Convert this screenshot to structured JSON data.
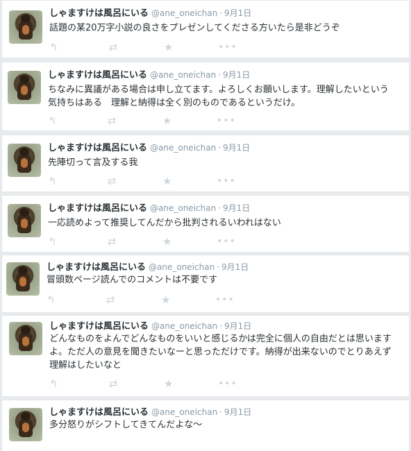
{
  "tweets": [
    {
      "name": "しゃますけは風呂にいる",
      "handle": "@ane_oneichan",
      "dot": "·",
      "date": "9月1日",
      "text": "話題の某20万字小説の良さをプレゼンしてくださる方いたら是非どうぞ"
    },
    {
      "name": "しゃますけは風呂にいる",
      "handle": "@ane_oneichan",
      "dot": "·",
      "date": "9月1日",
      "text": "ちなみに異議がある場合は申し立てます。よろしくお願いします。理解したいという気持ちはある　理解と納得は全く別のものであるというだけ。"
    },
    {
      "name": "しゃますけは風呂にいる",
      "handle": "@ane_oneichan",
      "dot": "·",
      "date": "9月1日",
      "text": "先陣切って言及する我"
    },
    {
      "name": "しゃますけは風呂にいる",
      "handle": "@ane_oneichan",
      "dot": "·",
      "date": "9月1日",
      "text": "一応読めよって推奨してんだから批判されるいわれはない"
    },
    {
      "name": "しゃますけは風呂にいる",
      "handle": "@ane_oneichan",
      "dot": "·",
      "date": "9月1日",
      "text": "冒頭数ページ読んでのコメントは不要です"
    },
    {
      "name": "しゃますけは風呂にいる",
      "handle": "@ane_oneichan",
      "dot": "·",
      "date": "9月1日",
      "text": "どんなものをよんでどんなものをいいと感じるかは完全に個人の自由だとは思いますよ。ただ人の意見を聞きたいなーと思っただけです。納得が出来ないのでとりあえず理解はしたいなと"
    },
    {
      "name": "しゃますけは風呂にいる",
      "handle": "@ane_oneichan",
      "dot": "·",
      "date": "9月1日",
      "text": "多分怒りがシフトしてきてんだよな〜"
    }
  ],
  "icons": {
    "reply": "reply-icon",
    "retweet": "retweet-icon",
    "favorite": "star-icon",
    "more": "more-icon"
  },
  "colors": {
    "name": "#292f33",
    "meta": "#8899a6",
    "action": "#ccd6dd",
    "border": "#e1e8ed"
  }
}
